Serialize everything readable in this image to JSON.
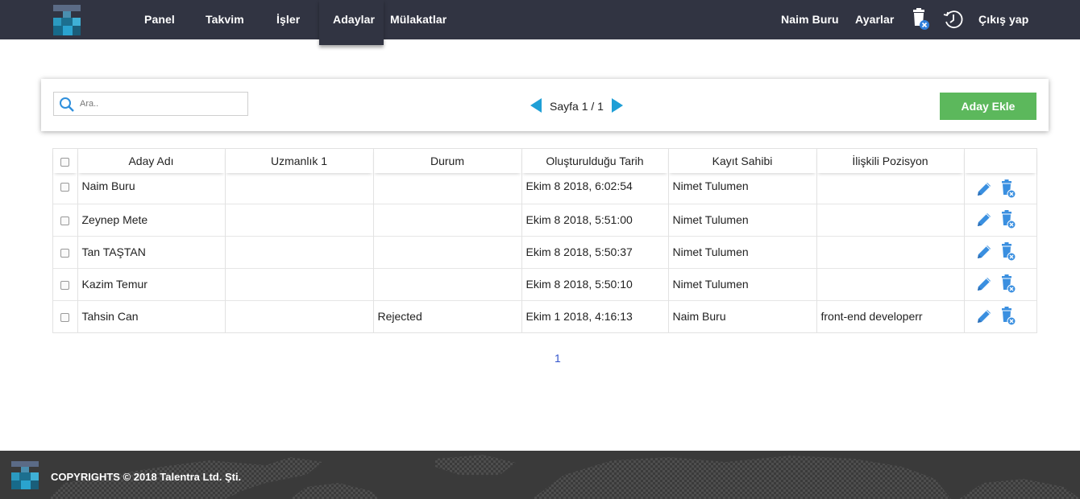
{
  "nav": {
    "items": [
      "Panel",
      "Takvim",
      "İşler",
      "Adaylar",
      "Mülakatlar"
    ],
    "active": "Adaylar",
    "user_name": "Naim Buru",
    "settings_label": "Ayarlar",
    "logout_label": "Çıkış yap",
    "icons": [
      "trash-icon",
      "history-icon"
    ]
  },
  "toolbar": {
    "search_placeholder": "Ara..",
    "page_label": "Sayfa 1 / 1",
    "add_button_label": "Aday Ekle"
  },
  "table": {
    "columns": [
      "Aday Adı",
      "Uzmanlık 1",
      "Durum",
      "Oluşturulduğu Tarih",
      "Kayıt Sahibi",
      "İlişkili Pozisyon"
    ],
    "rows": [
      {
        "name": "Naim Buru",
        "expertise": "",
        "status": "",
        "created": "Ekim 8 2018, 6:02:54",
        "owner": "Nimet Tulumen",
        "position": ""
      },
      {
        "name": "Zeynep Mete",
        "expertise": "",
        "status": "",
        "created": "Ekim 8 2018, 5:51:00",
        "owner": "Nimet Tulumen",
        "position": ""
      },
      {
        "name": "Tan TAŞTAN",
        "expertise": "",
        "status": "",
        "created": "Ekim 8 2018, 5:50:37",
        "owner": "Nimet Tulumen",
        "position": ""
      },
      {
        "name": "Kazim Temur",
        "expertise": "",
        "status": "",
        "created": "Ekim 8 2018, 5:50:10",
        "owner": "Nimet Tulumen",
        "position": ""
      },
      {
        "name": "Tahsin Can",
        "expertise": "",
        "status": "Rejected",
        "created": "Ekim 1 2018, 4:16:13",
        "owner": "Naim Buru",
        "position": "front-end developerr"
      }
    ],
    "row_actions": [
      "edit-icon",
      "delete-icon"
    ]
  },
  "pagination": {
    "current": "1"
  },
  "footer": {
    "copyright": "COPYRIGHTS © 2018 Talentra Ltd. Şti."
  },
  "colors": {
    "topbar": "#313442",
    "accent_blue": "#1f9fd6",
    "icon_blue": "#3a8fe0",
    "add_button": "#5cb85c",
    "footer": "#3a3a3a"
  }
}
